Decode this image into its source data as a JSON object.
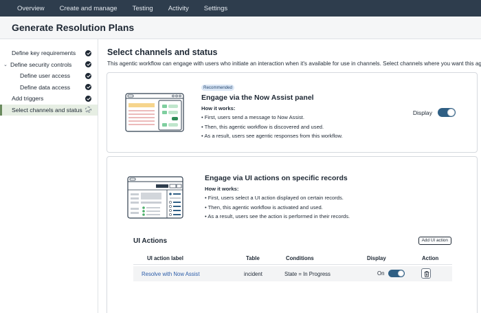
{
  "topnav": {
    "items": [
      "Overview",
      "Create and manage",
      "Testing",
      "Activity",
      "Settings"
    ]
  },
  "header": {
    "title": "Generate Resolution Plans"
  },
  "sidebar": {
    "items": [
      {
        "label": "Define key requirements",
        "status": "complete"
      },
      {
        "label": "Define security controls",
        "status": "complete",
        "expanded": true
      },
      {
        "label": "Define user access",
        "status": "complete",
        "indent": true
      },
      {
        "label": "Define data access",
        "status": "complete",
        "indent": true
      },
      {
        "label": "Add triggers",
        "status": "complete"
      },
      {
        "label": "Select channels and status",
        "status": "in-progress",
        "active": true
      }
    ]
  },
  "main": {
    "title": "Select channels and status",
    "description": "This agentic workflow can engage with users who initiate an interaction when it's available for use in channels. Select channels where you want this ag"
  },
  "now_assist_card": {
    "badge": "Recommended",
    "title": "Engage via the Now Assist panel",
    "how_label": "How it works:",
    "bullets": [
      "First, users send a message to Now Assist.",
      "Then, this agentic workflow is discovered and used.",
      "As a result, users see agentic responses from this workflow."
    ],
    "display_label": "Display",
    "display_on": true
  },
  "ui_actions_card": {
    "title": "Engage via UI actions on specific records",
    "how_label": "How it works:",
    "bullets": [
      "First, users select a UI action displayed on certain records.",
      "Then, this agentic workflow is activated and used.",
      "As a result, users see the action is performed in their records."
    ],
    "section_title": "UI Actions",
    "add_button": "Add UI action",
    "columns": [
      "UI action label",
      "Table",
      "Conditions",
      "Display",
      "Action"
    ],
    "rows": [
      {
        "label": "Resolve with Now Assist",
        "table": "incident",
        "conditions": "State = In Progress",
        "display_text": "On",
        "display_on": true
      }
    ]
  },
  "colors": {
    "topnav_bg": "#2e3d4d",
    "accent_toggle": "#2f5f84",
    "active_sidebar": "#e6eee3",
    "link": "#2a5ba8"
  },
  "icons": [
    "check-circle-icon",
    "in-progress-icon",
    "chevron-down-icon",
    "trash-icon"
  ]
}
